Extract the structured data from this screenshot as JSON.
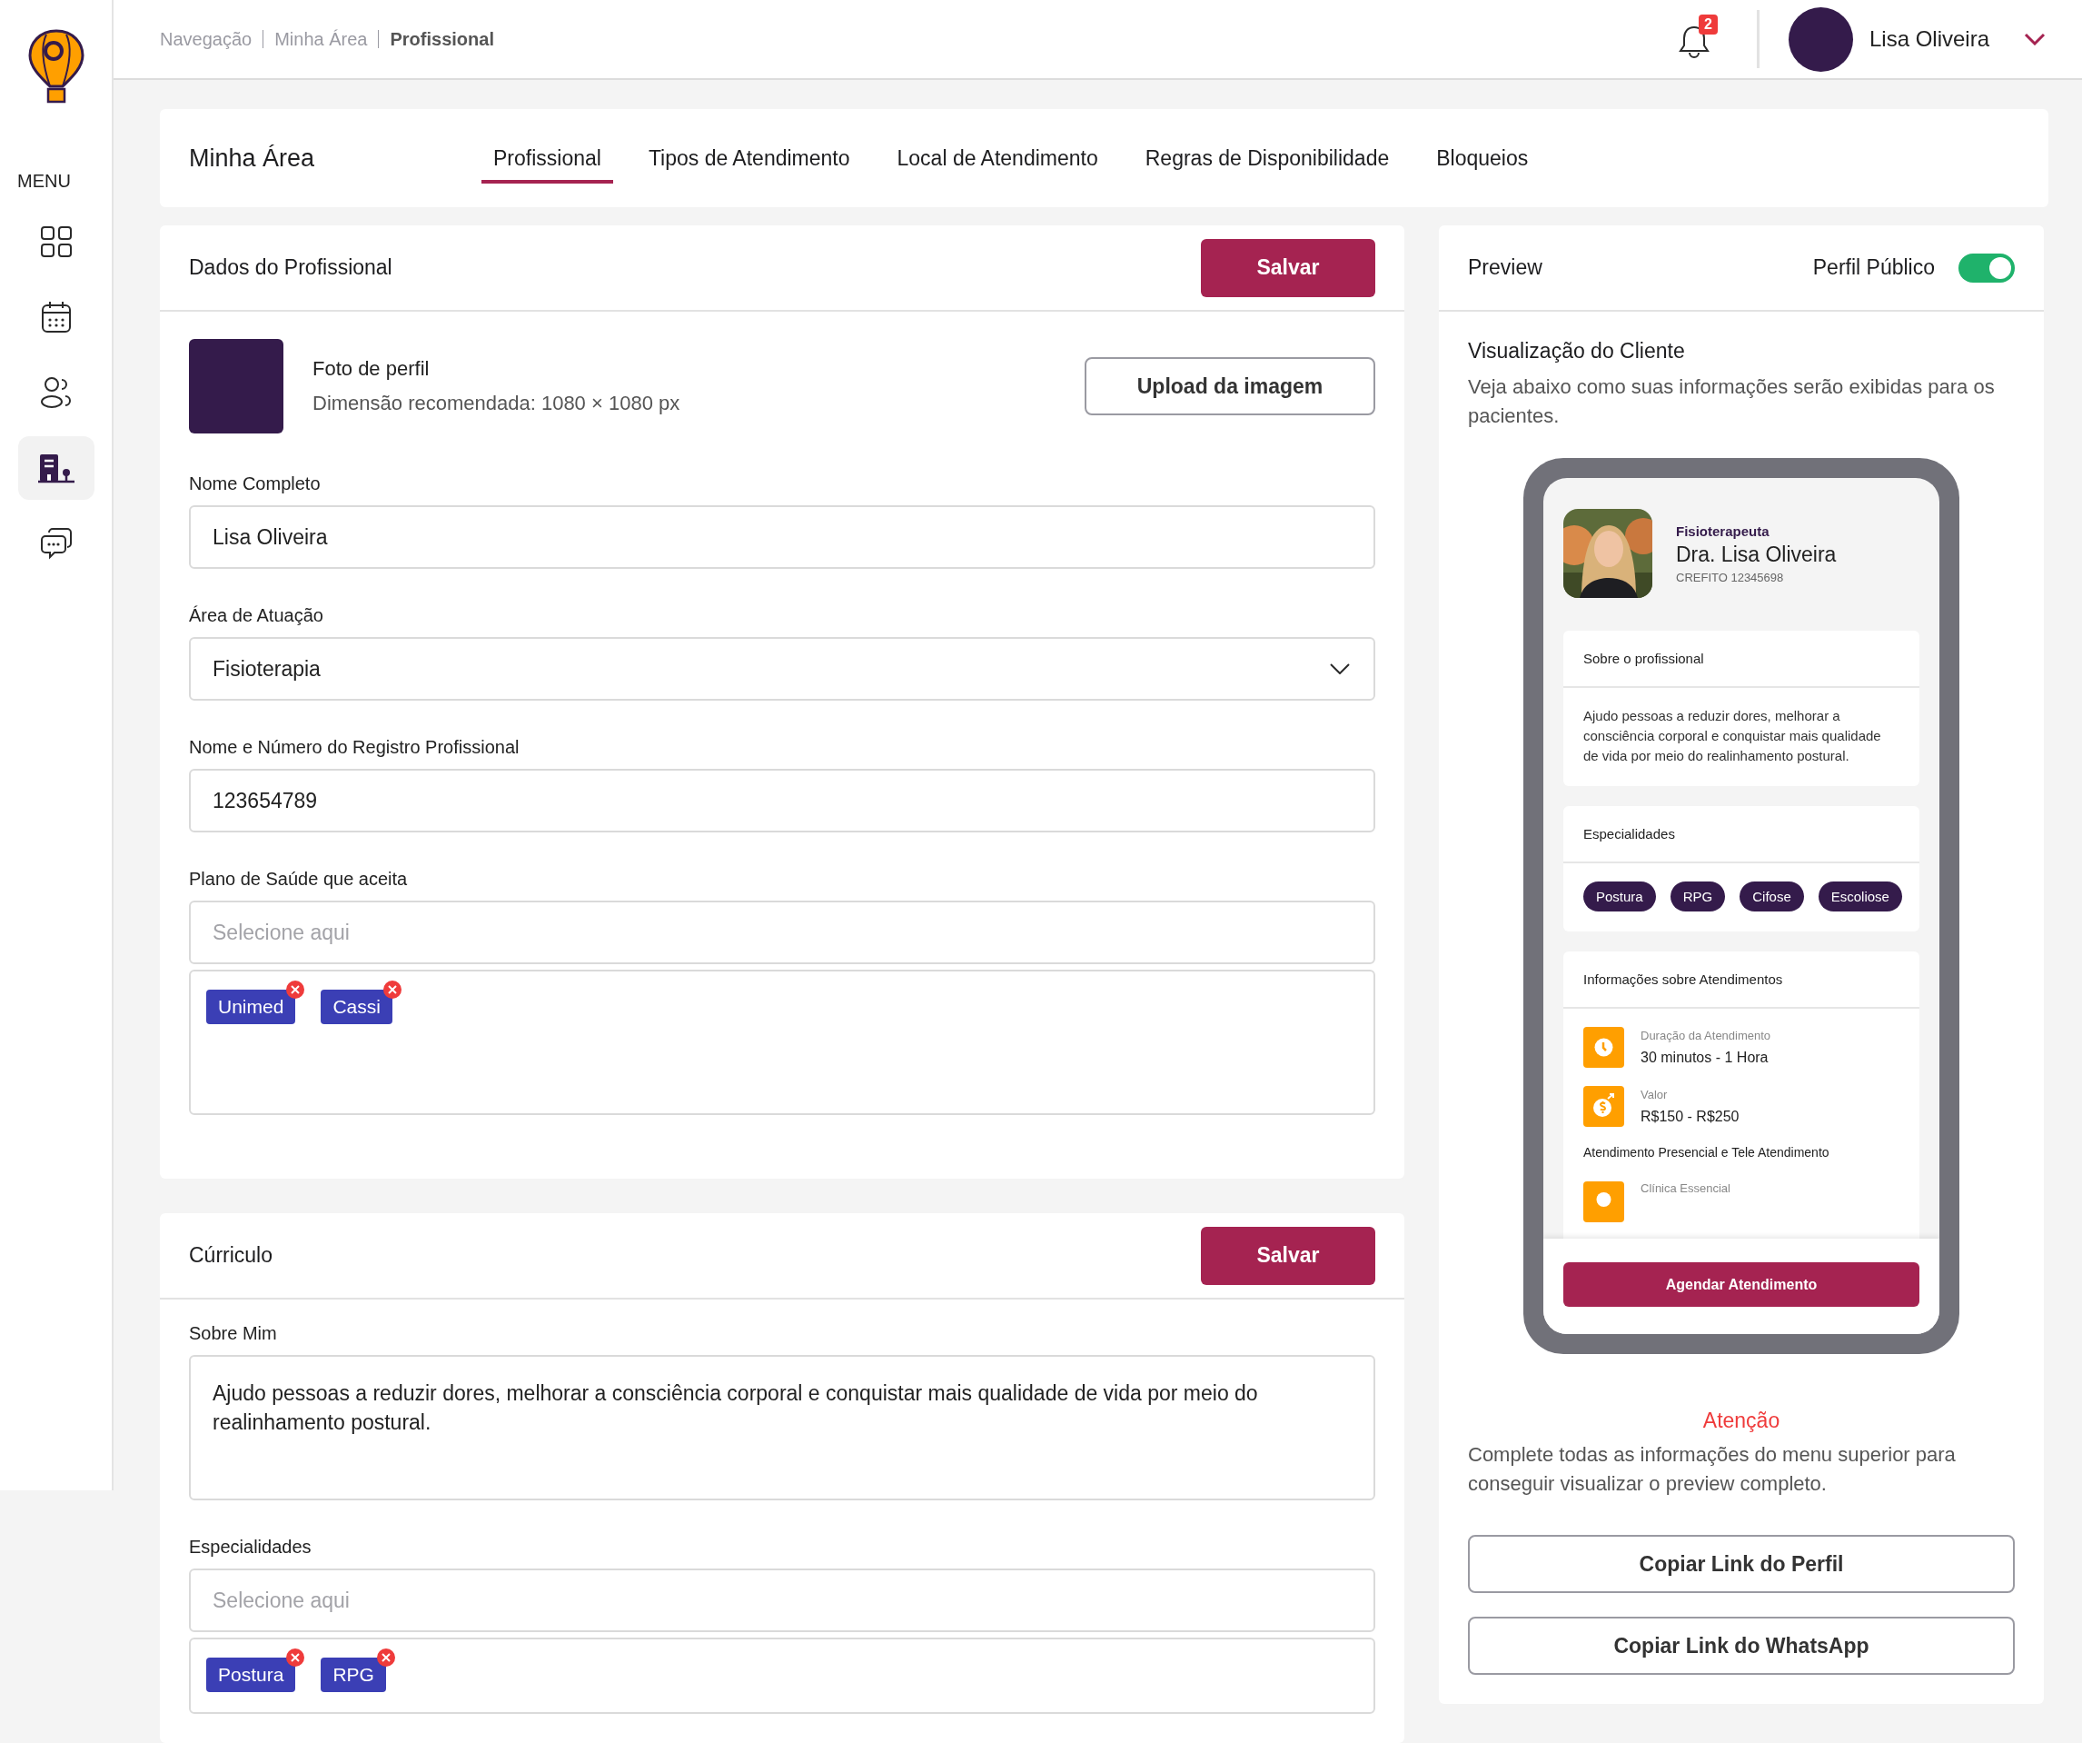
{
  "sidebar": {
    "menu_label": "MENU",
    "items": [
      {
        "kind": "grid",
        "selected": false
      },
      {
        "kind": "calendar",
        "selected": false
      },
      {
        "kind": "users",
        "selected": false
      },
      {
        "kind": "building",
        "selected": true
      },
      {
        "kind": "chat",
        "selected": false
      }
    ]
  },
  "header": {
    "breadcrumb": [
      {
        "label": "Navegação",
        "selected": false
      },
      {
        "label": "Minha Área",
        "selected": false
      },
      {
        "label": "Profissional",
        "selected": true
      }
    ],
    "notifications": {
      "count": "2"
    },
    "user": {
      "name": "Lisa Oliveira"
    }
  },
  "page": {
    "title": "Minha Área",
    "tabs": [
      {
        "label": "Profissional",
        "selected": true
      },
      {
        "label": "Tipos de Atendimento",
        "selected": false
      },
      {
        "label": "Local de Atendimento",
        "selected": false
      },
      {
        "label": "Regras de Disponibilidade",
        "selected": false
      },
      {
        "label": "Bloqueios",
        "selected": false
      }
    ]
  },
  "professional_data": {
    "title": "Dados do Profissional",
    "save_button": "Salvar",
    "photo": {
      "title": "Foto de perfil",
      "hint": "Dimensão recomendada: 1080 × 1080 px",
      "upload_button": "Upload da imagem"
    },
    "fields": [
      {
        "kind": "text",
        "label": "Nome Completo",
        "value": "Lisa Oliveira"
      },
      {
        "kind": "select",
        "label": "Área de Atuação",
        "value": "Fisioterapia"
      },
      {
        "kind": "text",
        "label": "Nome e Número do Registro Profissional",
        "value": "123654789"
      },
      {
        "kind": "tags",
        "label": "Plano de Saúde que aceita",
        "placeholder": "Selecione aqui",
        "tags": [
          "Unimed",
          "Cassi"
        ]
      }
    ]
  },
  "curriculum": {
    "title": "Cúrriculo",
    "save_button": "Salvar",
    "fields": [
      {
        "kind": "textarea",
        "label": "Sobre Mim",
        "value": "Ajudo pessoas a reduzir dores, melhorar a consciência corporal e conquistar mais qualidade de vida por meio do realinhamento postural."
      },
      {
        "kind": "tags",
        "label": "Especialidades",
        "placeholder": "Selecione aqui",
        "tags": [
          "Postura",
          "RPG"
        ]
      }
    ]
  },
  "preview": {
    "title": "Preview",
    "public_profile": {
      "label": "Perfil Público",
      "on": true
    },
    "client_view": {
      "title": "Visualização do Cliente",
      "description": "Veja abaixo como suas informações serão exibidas para os pacientes."
    },
    "phone": {
      "profession": "Fisioterapeuta",
      "name": "Dra. Lisa Oliveira",
      "registry": "CREFITO 12345698",
      "about": {
        "title": "Sobre o profissional",
        "text": "Ajudo pessoas a reduzir dores, melhorar a consciência corporal e conquistar mais qualidade de vida por meio do realinhamento postural."
      },
      "specialties": {
        "title": "Especialidades",
        "chips": [
          "Postura",
          "RPG",
          "Cifose",
          "Escoliose"
        ]
      },
      "appointments": {
        "title": "Informações sobre Atendimentos",
        "items": [
          {
            "kind": "clock",
            "label": "Duração da Atendimento",
            "value": "30 minutos - 1 Hora"
          },
          {
            "kind": "money",
            "label": "Valor",
            "value": "R$150 - R$250"
          }
        ],
        "subtitle": "Atendimento Presencial e Tele Atendimento",
        "places": [
          {
            "kind": "pin",
            "label": "Clínica Essencial"
          }
        ]
      },
      "button": "Agendar Atendimento"
    },
    "warning": {
      "title": "Atenção",
      "text": "Complete todas as informações do menu superior para conseguir visualizar o preview completo."
    },
    "buttons": [
      "Copiar Link do Perfil",
      "Copiar Link do WhatsApp"
    ]
  }
}
